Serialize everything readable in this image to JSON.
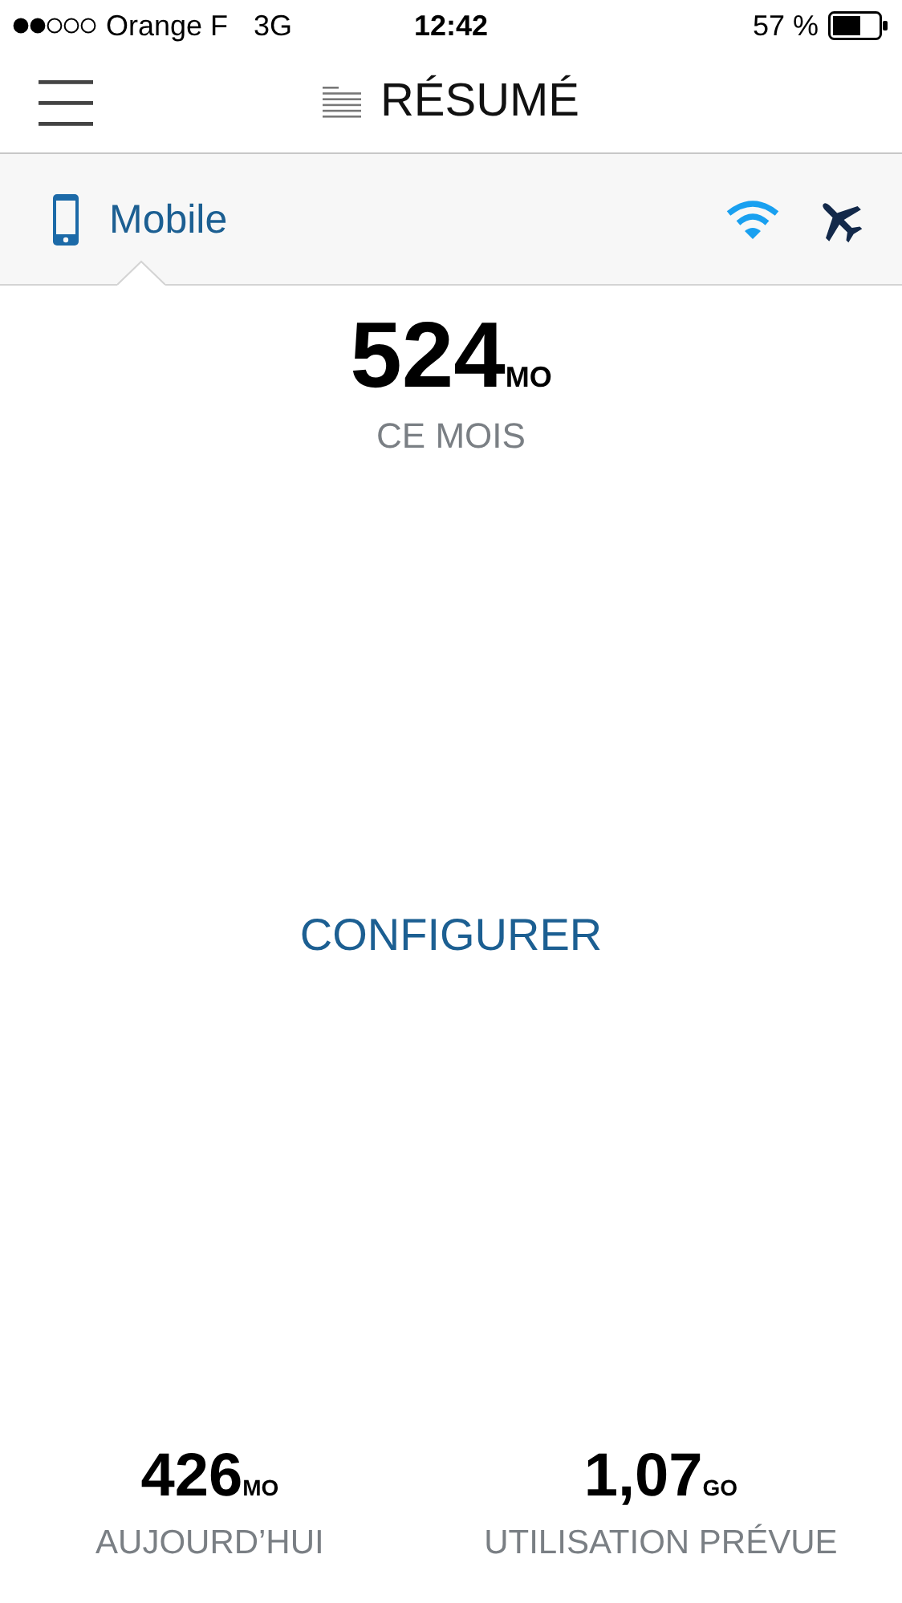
{
  "status_bar": {
    "carrier": "Orange F",
    "network": "3G",
    "time": "12:42",
    "battery": "57 %"
  },
  "header": {
    "title": "RÉSUMÉ"
  },
  "tabs": [
    {
      "kind": "mobile",
      "label": "Mobile",
      "selected": true
    },
    {
      "kind": "wifi",
      "selected": false
    },
    {
      "kind": "plane",
      "selected": false
    }
  ],
  "usage": {
    "value": "524",
    "unit": "MO",
    "label": "CE MOIS"
  },
  "configure_button": "CONFIGURER",
  "stats": [
    {
      "value": "426",
      "unit": "MO",
      "label": "AUJOURD’HUI"
    },
    {
      "value": "1,07",
      "unit": "GO",
      "label": "UTILISATION PRÉVUE"
    }
  ]
}
